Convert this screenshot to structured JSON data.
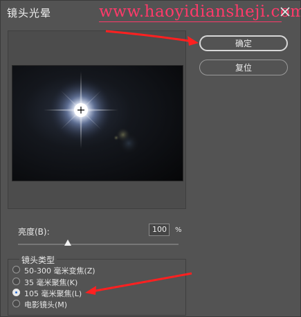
{
  "dialog": {
    "title": "镜头光晕",
    "watermark": "www.haoyidiansheji.com"
  },
  "buttons": {
    "ok_label": "确定",
    "reset_label": "复位"
  },
  "brightness": {
    "label": "亮度(B):",
    "value": "100",
    "unit": "%",
    "slider_fraction": 0.31
  },
  "lens_type": {
    "title": "镜头类型",
    "options": [
      {
        "label": "50-300 毫米变焦(Z)",
        "selected": false
      },
      {
        "label": "35 毫米聚焦(K)",
        "selected": false
      },
      {
        "label": "105 毫米聚焦(L)",
        "selected": true
      },
      {
        "label": "电影镜头(M)",
        "selected": false
      }
    ]
  },
  "colors": {
    "panel": "#535353",
    "watermark": "#ff3a6a",
    "arrow": "#ff2020"
  },
  "icons": {
    "close": "close-icon",
    "crosshair": "crosshair-icon"
  }
}
